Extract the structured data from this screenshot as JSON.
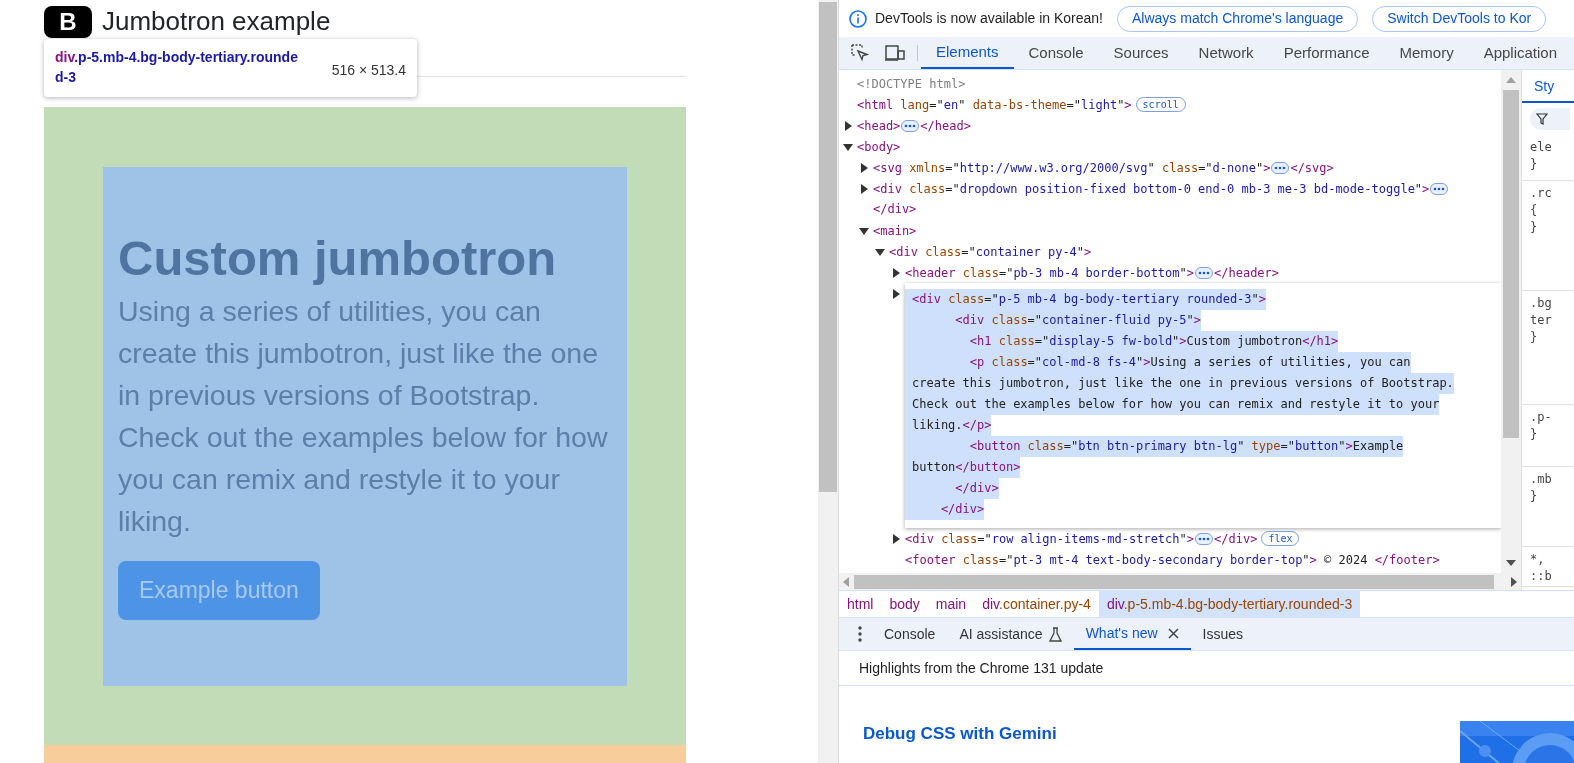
{
  "page": {
    "logo": "B",
    "title": "Jumbotron example",
    "heading": "Custom jumbotron",
    "paragraph": "Using a series of utilities, you can create this jumbotron, just like the one in previous versions of Bootstrap. Check out the examples below for how you can remix and restyle it to your liking.",
    "button": "Example button"
  },
  "inspect_tooltip": {
    "tag": "div",
    "classes": ".p-5.mb-4.bg-body-tertiary.rounded-3",
    "size": "516 × 513.4"
  },
  "infobar": {
    "message": "DevTools is now available in Korean!",
    "buttons": [
      "Always match Chrome's language",
      "Switch DevTools to Kor"
    ]
  },
  "tabs": [
    {
      "label": "Elements",
      "selected": true
    },
    {
      "label": "Console",
      "selected": false
    },
    {
      "label": "Sources",
      "selected": false
    },
    {
      "label": "Network",
      "selected": false
    },
    {
      "label": "Performance",
      "selected": false
    },
    {
      "label": "Memory",
      "selected": false
    },
    {
      "label": "Application",
      "selected": false
    }
  ],
  "tree": [
    {
      "kind": "line",
      "tokens": [
        {
          "kind": "comment",
          "text": "<!DOCTYPE html>"
        }
      ]
    },
    {
      "kind": "line",
      "tokens": [
        {
          "kind": "tag",
          "text": "<html "
        },
        {
          "kind": "attr",
          "text": "lang"
        },
        {
          "kind": "text",
          "text": "=\""
        },
        {
          "kind": "value",
          "text": "en"
        },
        {
          "kind": "text",
          "text": "\" "
        },
        {
          "kind": "attr",
          "text": "data-bs-theme"
        },
        {
          "kind": "text",
          "text": "=\""
        },
        {
          "kind": "value",
          "text": "light"
        },
        {
          "kind": "text",
          "text": "\""
        },
        {
          "kind": "tag",
          "text": ">"
        }
      ],
      "badge": "scroll"
    },
    {
      "kind": "node",
      "expanded": false,
      "tokens": [
        {
          "kind": "tag",
          "text": "<head>"
        }
      ],
      "ellipsis": true,
      "close_tokens": [
        {
          "kind": "tag",
          "text": "</head>"
        }
      ]
    },
    {
      "kind": "node",
      "expanded": true,
      "tokens": [
        {
          "kind": "tag",
          "text": "<body>"
        }
      ],
      "children": [
        {
          "kind": "node",
          "expanded": false,
          "tokens": [
            {
              "kind": "tag",
              "text": "<svg "
            },
            {
              "kind": "attr",
              "text": "xmlns"
            },
            {
              "kind": "text",
              "text": "=\""
            },
            {
              "kind": "value",
              "text": "http://www.w3.org/2000/svg"
            },
            {
              "kind": "text",
              "text": "\" "
            },
            {
              "kind": "attr",
              "text": "class"
            },
            {
              "kind": "text",
              "text": "=\""
            },
            {
              "kind": "value",
              "text": "d-none"
            },
            {
              "kind": "text",
              "text": "\""
            },
            {
              "kind": "tag",
              "text": ">"
            }
          ],
          "ellipsis": true,
          "close_tokens": [
            {
              "kind": "tag",
              "text": "</svg>"
            }
          ]
        },
        {
          "kind": "node",
          "expanded": false,
          "tokens": [
            {
              "kind": "tag",
              "text": "<div "
            },
            {
              "kind": "attr",
              "text": "class"
            },
            {
              "kind": "text",
              "text": "=\""
            },
            {
              "kind": "value",
              "text": "dropdown position-fixed bottom-0 end-0 mb-3 me-3 bd-mode-toggle"
            },
            {
              "kind": "text",
              "text": "\""
            },
            {
              "kind": "tag",
              "text": ">"
            }
          ],
          "ellipsis": true,
          "continuation_tokens": [
            {
              "kind": "tag",
              "text": "</div>"
            }
          ]
        },
        {
          "kind": "node",
          "expanded": true,
          "tokens": [
            {
              "kind": "tag",
              "text": "<main>"
            }
          ],
          "children": [
            {
              "kind": "node",
              "expanded": true,
              "tokens": [
                {
                  "kind": "tag",
                  "text": "<div "
                },
                {
                  "kind": "attr",
                  "text": "class"
                },
                {
                  "kind": "text",
                  "text": "=\""
                },
                {
                  "kind": "value",
                  "text": "container py-4"
                },
                {
                  "kind": "text",
                  "text": "\""
                },
                {
                  "kind": "tag",
                  "text": ">"
                }
              ],
              "children": [
                {
                  "kind": "node",
                  "expanded": false,
                  "tokens": [
                    {
                      "kind": "tag",
                      "text": "<header "
                    },
                    {
                      "kind": "attr",
                      "text": "class"
                    },
                    {
                      "kind": "text",
                      "text": "=\""
                    },
                    {
                      "kind": "value",
                      "text": "pb-3 mb-4 border-bottom"
                    },
                    {
                      "kind": "text",
                      "text": "\""
                    },
                    {
                      "kind": "tag",
                      "text": ">"
                    }
                  ],
                  "ellipsis": true,
                  "close_tokens": [
                    {
                      "kind": "tag",
                      "text": "</header>"
                    }
                  ]
                },
                {
                  "kind": "popup",
                  "expanded": false,
                  "lines": [
                    [
                      {
                        "kind": "tag",
                        "text": "<div "
                      },
                      {
                        "kind": "attr",
                        "text": "class"
                      },
                      {
                        "kind": "text",
                        "text": "=\""
                      },
                      {
                        "kind": "value",
                        "text": "p-5 mb-4 bg-body-tertiary rounded-3"
                      },
                      {
                        "kind": "text",
                        "text": "\""
                      },
                      {
                        "kind": "tag",
                        "text": ">"
                      }
                    ],
                    [
                      {
                        "kind": "tag",
                        "text": "      <div "
                      },
                      {
                        "kind": "attr",
                        "text": "class"
                      },
                      {
                        "kind": "text",
                        "text": "=\""
                      },
                      {
                        "kind": "value",
                        "text": "container-fluid py-5"
                      },
                      {
                        "kind": "text",
                        "text": "\""
                      },
                      {
                        "kind": "tag",
                        "text": ">"
                      }
                    ],
                    [
                      {
                        "kind": "tag",
                        "text": "        <h1 "
                      },
                      {
                        "kind": "attr",
                        "text": "class"
                      },
                      {
                        "kind": "text",
                        "text": "=\""
                      },
                      {
                        "kind": "value",
                        "text": "display-5 fw-bold"
                      },
                      {
                        "kind": "text",
                        "text": "\""
                      },
                      {
                        "kind": "tag",
                        "text": ">"
                      },
                      {
                        "kind": "text",
                        "text": "Custom jumbotron"
                      },
                      {
                        "kind": "tag",
                        "text": "</h1>"
                      }
                    ],
                    [
                      {
                        "kind": "tag",
                        "text": "        <p "
                      },
                      {
                        "kind": "attr",
                        "text": "class"
                      },
                      {
                        "kind": "text",
                        "text": "=\""
                      },
                      {
                        "kind": "value",
                        "text": "col-md-8 fs-4"
                      },
                      {
                        "kind": "text",
                        "text": "\""
                      },
                      {
                        "kind": "tag",
                        "text": ">"
                      },
                      {
                        "kind": "text",
                        "text": "Using a series of utilities, you can"
                      }
                    ],
                    [
                      {
                        "kind": "text",
                        "text": "create this jumbotron, just like the one in previous versions of Bootstrap."
                      }
                    ],
                    [
                      {
                        "kind": "text",
                        "text": "Check out the examples below for how you can remix and restyle it to your"
                      }
                    ],
                    [
                      {
                        "kind": "text",
                        "text": "liking."
                      },
                      {
                        "kind": "tag",
                        "text": "</p>"
                      }
                    ],
                    [
                      {
                        "kind": "tag",
                        "text": "        <button "
                      },
                      {
                        "kind": "attr",
                        "text": "class"
                      },
                      {
                        "kind": "text",
                        "text": "=\""
                      },
                      {
                        "kind": "value",
                        "text": "btn btn-primary btn-lg"
                      },
                      {
                        "kind": "text",
                        "text": "\" "
                      },
                      {
                        "kind": "attr",
                        "text": "type"
                      },
                      {
                        "kind": "text",
                        "text": "=\""
                      },
                      {
                        "kind": "value",
                        "text": "button"
                      },
                      {
                        "kind": "text",
                        "text": "\""
                      },
                      {
                        "kind": "tag",
                        "text": ">"
                      },
                      {
                        "kind": "text",
                        "text": "Example"
                      }
                    ],
                    [
                      {
                        "kind": "text",
                        "text": "button"
                      },
                      {
                        "kind": "tag",
                        "text": "</button>"
                      }
                    ],
                    [
                      {
                        "kind": "tag",
                        "text": "      </div>"
                      }
                    ],
                    [
                      {
                        "kind": "tag",
                        "text": "    </div>"
                      }
                    ]
                  ]
                },
                {
                  "kind": "node",
                  "expanded": false,
                  "tokens": [
                    {
                      "kind": "tag",
                      "text": "<div "
                    },
                    {
                      "kind": "attr",
                      "text": "class"
                    },
                    {
                      "kind": "text",
                      "text": "=\""
                    },
                    {
                      "kind": "value",
                      "text": "row align-items-md-stretch"
                    },
                    {
                      "kind": "text",
                      "text": "\""
                    },
                    {
                      "kind": "tag",
                      "text": ">"
                    }
                  ],
                  "ellipsis": true,
                  "close_tokens": [
                    {
                      "kind": "tag",
                      "text": "</div>"
                    }
                  ],
                  "badge": "flex"
                },
                {
                  "kind": "line",
                  "tokens": [
                    {
                      "kind": "tag",
                      "text": "<footer "
                    },
                    {
                      "kind": "attr",
                      "text": "class"
                    },
                    {
                      "kind": "text",
                      "text": "=\""
                    },
                    {
                      "kind": "value",
                      "text": "pt-3 mt-4 text-body-secondary border-top"
                    },
                    {
                      "kind": "text",
                      "text": "\""
                    },
                    {
                      "kind": "tag",
                      "text": ">"
                    },
                    {
                      "kind": "text",
                      "text": " © 2024 "
                    },
                    {
                      "kind": "tag",
                      "text": "</footer>"
                    }
                  ]
                }
              ]
            }
          ]
        }
      ]
    }
  ],
  "styles_pane": {
    "tab": "Sty",
    "rules": [
      {
        "lines": [
          "ele",
          "}"
        ]
      },
      {
        "lines": [
          ".rc",
          "{",
          "}"
        ]
      },
      {
        "lines": [
          ".bg",
          "ter",
          "}"
        ]
      },
      {
        "lines": [
          ".p-",
          "}"
        ]
      },
      {
        "lines": [
          ".mb",
          "}"
        ]
      },
      {
        "lines": [
          "*,",
          "::b"
        ]
      }
    ]
  },
  "breadcrumbs": [
    {
      "tag": "html",
      "selected": false
    },
    {
      "tag": "body",
      "selected": false
    },
    {
      "tag": "main",
      "selected": false
    },
    {
      "tag": "div",
      "classes": ".container.py-4",
      "selected": false
    },
    {
      "tag": "div",
      "classes": ".p-5.mb-4.bg-body-tertiary.rounded-3",
      "selected": true
    }
  ],
  "drawer_tabs": [
    {
      "label": "Console",
      "selected": false,
      "kind": "plain"
    },
    {
      "label": "AI assistance",
      "selected": false,
      "kind": "flask"
    },
    {
      "label": "What's new",
      "selected": true,
      "kind": "closable"
    },
    {
      "label": "Issues",
      "selected": false,
      "kind": "plain"
    }
  ],
  "whats_new": {
    "subtitle": "Highlights from the Chrome 131 update",
    "article_title": "Debug CSS with Gemini"
  }
}
